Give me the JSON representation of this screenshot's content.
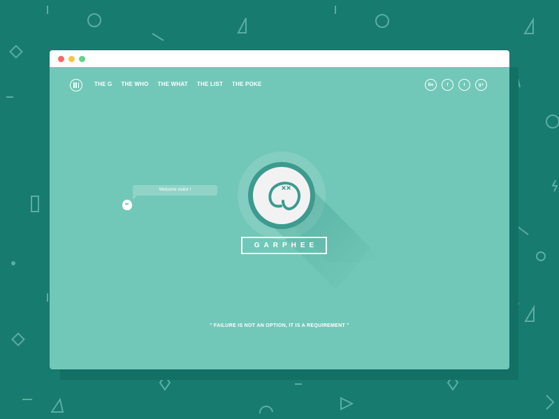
{
  "colors": {
    "background": "#177b70",
    "window_body": "#72c8b8",
    "window_titlebar": "#ffffff",
    "accent_dark": "#3c9b8e",
    "traffic_red": "#f56a6a",
    "traffic_yellow": "#f5c54a",
    "traffic_green": "#5ed68a"
  },
  "nav": {
    "items": [
      {
        "label": "THE G"
      },
      {
        "label": "THE WHO"
      },
      {
        "label": "THE WHAT"
      },
      {
        "label": "THE LIST"
      },
      {
        "label": "THE POKE"
      }
    ]
  },
  "social": [
    {
      "icon": "dribbble-icon",
      "glyph": "Be"
    },
    {
      "icon": "facebook-icon",
      "glyph": "f"
    },
    {
      "icon": "twitter-icon",
      "glyph": "t"
    },
    {
      "icon": "google-plus-icon",
      "glyph": "g+"
    }
  ],
  "hero": {
    "brand": "GARPHEE",
    "tagline": "\" FAILURE IS NOT AN OPTION, IT IS A REQUIREMENT \""
  },
  "chat": {
    "greeting": "Welcome visitor !"
  }
}
